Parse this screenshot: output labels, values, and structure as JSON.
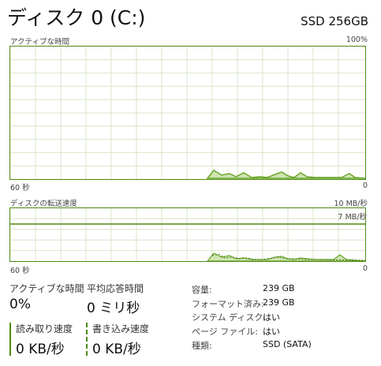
{
  "header": {
    "title": "ディスク 0 (C:)",
    "model": "SSD 256GB"
  },
  "activity_graph": {
    "label": "アクティブな時間",
    "max_label": "100%",
    "time_label": "60 秒",
    "min_label": "0",
    "color": "#4f8a10"
  },
  "speed_graph": {
    "label": "ディスクの転送速度",
    "max_label": "10 MB/秒",
    "marker_label": "7 MB/秒",
    "time_label": "60 秒",
    "min_label": "0",
    "color": "#4f8a10"
  },
  "stats": {
    "active_time": {
      "label": "アクティブな時間",
      "value": "0%"
    },
    "response_time": {
      "label": "平均応答時間",
      "value": "0 ミリ秒"
    },
    "read_speed": {
      "label": "読み取り速度",
      "value": "0 KB/秒"
    },
    "write_speed": {
      "label": "書き込み速度",
      "value": "0 KB/秒"
    }
  },
  "properties": [
    {
      "label": "容量:",
      "value": "239 GB"
    },
    {
      "label": "フォーマット済み:",
      "value": "239 GB"
    },
    {
      "label": "システム ディスク:",
      "value": "はい"
    },
    {
      "label": "ページ ファイル:",
      "value": "はい"
    },
    {
      "label": "種類:",
      "value": "SSD (SATA)"
    }
  ]
}
